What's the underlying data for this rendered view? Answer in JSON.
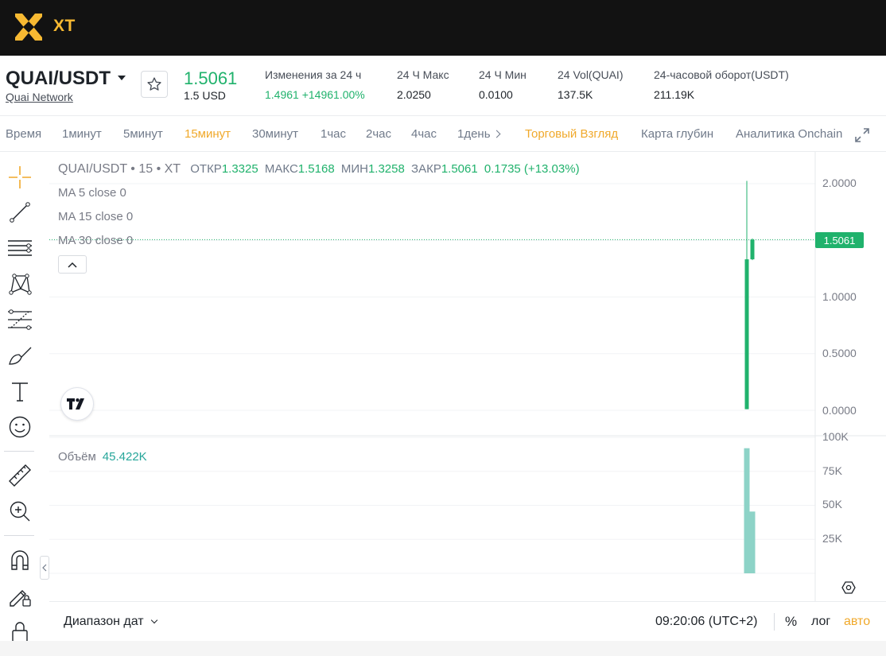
{
  "header": {
    "logo_text": "XT",
    "brand_color": "#f7b932"
  },
  "ticker": {
    "pair": "QUAI/USDT",
    "network": "Quai Network",
    "price": "1.5061",
    "price_usd": "1.5 USD",
    "stats": [
      {
        "label": "Изменения за 24 ч",
        "value": "1.4961 +14961.00%",
        "green": true
      },
      {
        "label": "24 Ч Макс",
        "value": "2.0250",
        "green": false
      },
      {
        "label": "24 Ч Мин",
        "value": "0.0100",
        "green": false
      },
      {
        "label": "24 Vol(QUAI)",
        "value": "137.5K",
        "green": false
      },
      {
        "label": "24-часовой оборот(USDT)",
        "value": "211.19K",
        "green": false
      }
    ]
  },
  "tabs": {
    "time": "Время",
    "intervals": [
      "1минут",
      "5минут",
      "15минут",
      "30минут",
      "1час",
      "2час",
      "4час",
      "1день"
    ],
    "active_interval": "15минут",
    "trading_view": "Торговый Взгляд",
    "depth": "Карта глубин",
    "onchain": "Аналитика Onchain"
  },
  "chart": {
    "legend": {
      "symbol": "QUAI/USDT • 15 • XT",
      "open_label": "ОТКР",
      "open": "1.3325",
      "high_label": "МАКС",
      "high": "1.5168",
      "low_label": "МИН",
      "low": "1.3258",
      "close_label": "ЗАКР",
      "close": "1.5061",
      "change": "0.1735 (+13.03%)"
    },
    "ma": [
      "MA 5 close 0",
      "MA 15 close 0",
      "MA 30 close 0"
    ],
    "volume_label": "Объём",
    "volume_value": "45.422K",
    "price_ticks": [
      "2.0000",
      "1.5061",
      "1.0000",
      "0.5000",
      "0.0000"
    ],
    "volume_ticks": [
      "100K",
      "75K",
      "50K",
      "25K"
    ],
    "current_price": "1.5061",
    "up_color": "#20b26c",
    "volume_color": "#8dd3c7"
  },
  "chart_data": {
    "type": "candlestick",
    "candles": [
      {
        "open": 0.01,
        "high": 2.025,
        "low": 0.01,
        "close": 1.3325
      },
      {
        "open": 1.3325,
        "high": 1.5168,
        "low": 1.3258,
        "close": 1.5061
      }
    ],
    "volume": [
      92000,
      45422
    ],
    "ylim": [
      0,
      2.0
    ],
    "volume_ylim": [
      0,
      100000
    ]
  },
  "bottom": {
    "date_range": "Диапазон дат",
    "time": "09:20:06 (UTC+2)",
    "percent": "%",
    "log": "лог",
    "auto": "авто"
  }
}
